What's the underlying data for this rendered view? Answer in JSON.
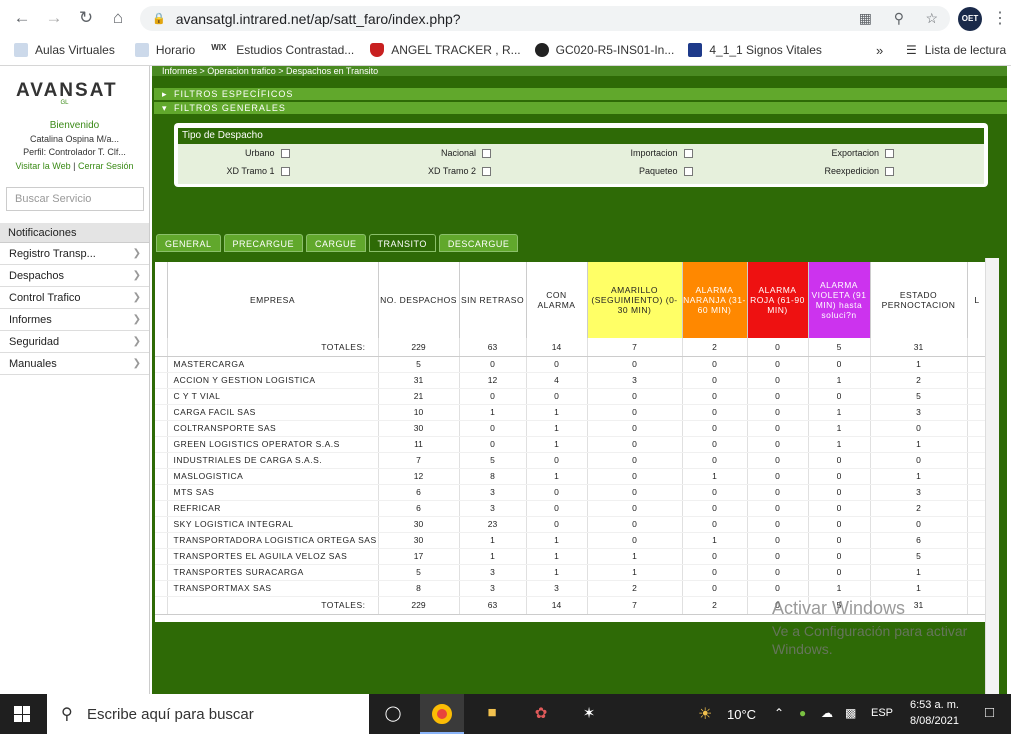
{
  "browser": {
    "url": "avansatgl.intrared.net/ap/satt_faro/index.php?",
    "profile": "OET"
  },
  "bookmarks": [
    "Aulas Virtuales",
    "Horario",
    "Estudios Contrastad...",
    "ANGEL TRACKER , R...",
    "GC020-R5-INS01-In...",
    "4_1_1 Signos Vitales"
  ],
  "reading_list": "Lista de lectura",
  "sidebar": {
    "logo": "AVANSAT",
    "logo_sub": "GL",
    "welcome": "Bienvenido",
    "user": "Catalina Ospina M/a...",
    "profile": "Perfil: Controlador T. Clf...",
    "visit": "Visitar la Web",
    "sep": "|",
    "logout": "Cerrar Sesión",
    "search_placeholder": "Buscar Servicio",
    "notifications": "Notificaciones",
    "items": [
      "Registro Transp...",
      "Despachos",
      "Control Trafico",
      "Informes",
      "Seguridad",
      "Manuales"
    ]
  },
  "main": {
    "breadcrumb": "Informes > Operacion trafico > Despachos en Transito",
    "filtros_especificos": "FILTROS ESPECÍFICOS",
    "filtros_generales": "FILTROS GENERALES",
    "tipo_despacho": "Tipo de Despacho",
    "filters": [
      "Urbano",
      "Nacional",
      "Importacion",
      "Exportacion",
      "XD Tramo 1",
      "XD Tramo 2",
      "Paqueteo",
      "Reexpedicion"
    ],
    "tabs": [
      "GENERAL",
      "PRECARGUE",
      "CARGUE",
      "TRANSITO",
      "DESCARGUE"
    ],
    "headers": {
      "empresa": "EMPRESA",
      "no_despachos": "NO. DESPACHOS",
      "sin_retraso": "SIN RETRASO",
      "con_alarma": "CON ALARMA",
      "amarillo": "AMARILLO (SEGUIMIENTO) (0-30 MIN)",
      "naranja": "ALARMA NARANJA (31-60 MIN)",
      "roja": "ALARMA ROJA (61-90 MIN)",
      "violeta": "ALARMA VIOLETA (91 MIN) hasta soluci?n",
      "estado": "ESTADO PERNOCTACION",
      "extra": "L"
    },
    "colors": {
      "amarillo": "#ffff66",
      "naranja": "#ff8800",
      "roja": "#ee1111",
      "violeta": "#cc33ee",
      "green": "#2e6a06"
    },
    "totals_label": "TOTALES:",
    "totals": [
      "229",
      "63",
      "14",
      "7",
      "2",
      "0",
      "5",
      "31"
    ],
    "rows": [
      [
        "MASTERCARGA",
        "5",
        "0",
        "0",
        "0",
        "0",
        "0",
        "0",
        "1"
      ],
      [
        "ACCION Y GESTION LOGISTICA",
        "31",
        "12",
        "4",
        "3",
        "0",
        "0",
        "1",
        "2"
      ],
      [
        "C Y T VIAL",
        "21",
        "0",
        "0",
        "0",
        "0",
        "0",
        "0",
        "5"
      ],
      [
        "CARGA FACIL SAS",
        "10",
        "1",
        "1",
        "0",
        "0",
        "0",
        "1",
        "3"
      ],
      [
        "COLTRANSPORTE SAS",
        "30",
        "0",
        "1",
        "0",
        "0",
        "0",
        "1",
        "0"
      ],
      [
        "GREEN LOGISTICS OPERATOR S.A.S",
        "11",
        "0",
        "1",
        "0",
        "0",
        "0",
        "1",
        "1"
      ],
      [
        "INDUSTRIALES DE CARGA S.A.S.",
        "7",
        "5",
        "0",
        "0",
        "0",
        "0",
        "0",
        "0"
      ],
      [
        "MASLOGISTICA",
        "12",
        "8",
        "1",
        "0",
        "1",
        "0",
        "0",
        "1"
      ],
      [
        "MTS SAS",
        "6",
        "3",
        "0",
        "0",
        "0",
        "0",
        "0",
        "3"
      ],
      [
        "REFRICAR",
        "6",
        "3",
        "0",
        "0",
        "0",
        "0",
        "0",
        "2"
      ],
      [
        "SKY LOGISTICA INTEGRAL",
        "30",
        "23",
        "0",
        "0",
        "0",
        "0",
        "0",
        "0"
      ],
      [
        "TRANSPORTADORA LOGISTICA ORTEGA SAS",
        "30",
        "1",
        "1",
        "0",
        "1",
        "0",
        "0",
        "6"
      ],
      [
        "TRANSPORTES EL AGUILA VELOZ SAS",
        "17",
        "1",
        "1",
        "1",
        "0",
        "0",
        "0",
        "5"
      ],
      [
        "TRANSPORTES SURACARGA",
        "5",
        "3",
        "1",
        "1",
        "0",
        "0",
        "0",
        "1"
      ],
      [
        "TRANSPORTMAX SAS",
        "8",
        "3",
        "3",
        "2",
        "0",
        "0",
        "1",
        "1"
      ]
    ]
  },
  "watermark": {
    "line1": "Activar Windows",
    "line2": "Ve a Configuración para activar",
    "line3": "Windows."
  },
  "taskbar": {
    "search": "Escribe aquí para buscar",
    "temp": "10°C",
    "lang": "ESP",
    "time": "6:53 a. m.",
    "date": "8/08/2021"
  }
}
